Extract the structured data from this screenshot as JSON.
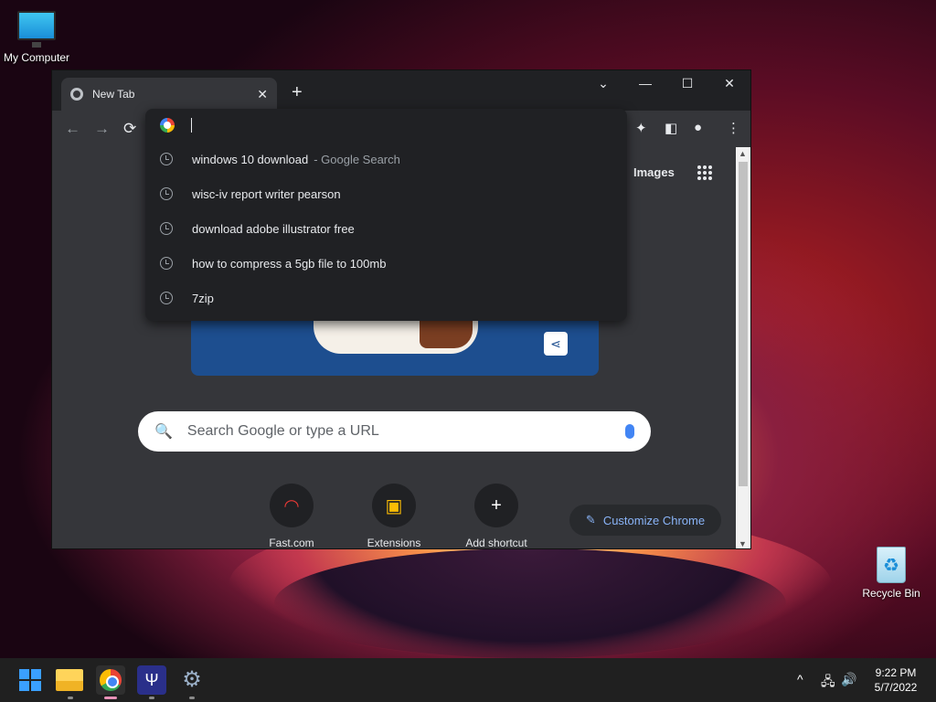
{
  "desktop": {
    "icons": [
      {
        "label": "My Computer"
      },
      {
        "label": "Recycle Bin"
      }
    ]
  },
  "browser": {
    "tab_title": "New Tab",
    "new_tab_symbol": "+",
    "window_controls": {
      "dropdown": "⌄",
      "minimize": "—",
      "maximize": "☐",
      "close": "✕"
    },
    "toolbar": {
      "back": "←",
      "forward": "→",
      "reload": "⟳"
    },
    "header_links": {
      "images": "Images"
    },
    "search_placeholder": "Search Google or type a URL",
    "shortcuts": [
      {
        "label": "Fast.com"
      },
      {
        "label": "Extensions"
      },
      {
        "label": "Add shortcut"
      }
    ],
    "customize_label": "Customize Chrome",
    "omnibox": {
      "value": "",
      "suggestions": [
        {
          "text": "windows 10 download",
          "suffix": "- Google Search"
        },
        {
          "text": "wisc-iv report writer pearson",
          "suffix": ""
        },
        {
          "text": "download adobe illustrator free",
          "suffix": ""
        },
        {
          "text": "how to compress a 5gb file to 100mb",
          "suffix": ""
        },
        {
          "text": "7zip",
          "suffix": ""
        }
      ]
    }
  },
  "taskbar": {
    "apps": [
      "start-icon",
      "file-explorer-icon",
      "chrome-icon",
      "psi-app-icon",
      "settings-icon"
    ],
    "tray": {
      "chevron": "^",
      "network": "🖧",
      "volume": "🔊"
    },
    "time": "9:22 PM",
    "date": "5/7/2022"
  },
  "colors": {
    "accent": "#8ab4f8",
    "window_bg": "#35363a",
    "dropdown_bg": "#202124",
    "taskbar_bg": "#202020"
  }
}
